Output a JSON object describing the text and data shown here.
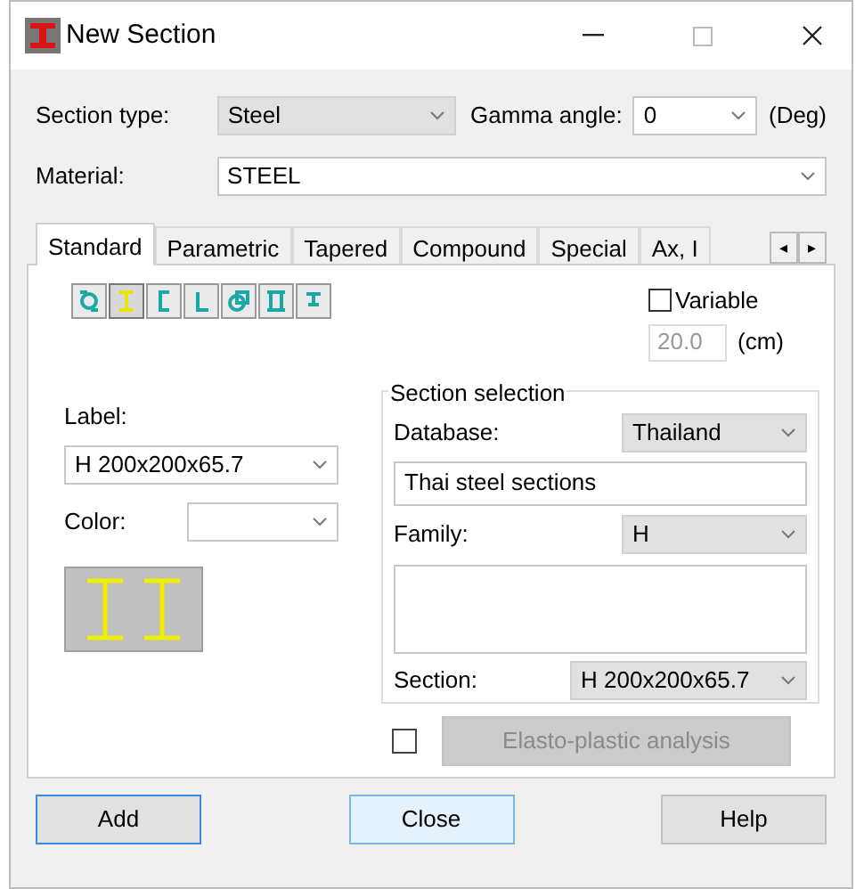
{
  "window": {
    "title": "New Section"
  },
  "section_type": {
    "label": "Section type:",
    "value": "Steel"
  },
  "gamma_angle": {
    "label": "Gamma angle:",
    "value": "0",
    "unit": "(Deg)"
  },
  "material": {
    "label": "Material:",
    "value": "STEEL"
  },
  "tabs": [
    {
      "label": "Standard",
      "selected": true
    },
    {
      "label": "Parametric",
      "selected": false
    },
    {
      "label": "Tapered",
      "selected": false
    },
    {
      "label": "Compound",
      "selected": false
    },
    {
      "label": "Special",
      "selected": false
    },
    {
      "label": "Ax, I",
      "selected": false
    }
  ],
  "tab_scroll": {
    "left": "◂",
    "right": "▸"
  },
  "shape_tools": [
    {
      "kind": "rolled",
      "selected": false
    },
    {
      "kind": "i",
      "selected": true
    },
    {
      "kind": "channel",
      "selected": false
    },
    {
      "kind": "angle",
      "selected": false
    },
    {
      "kind": "tube",
      "selected": false
    },
    {
      "kind": "double",
      "selected": false
    },
    {
      "kind": "tee",
      "selected": false
    }
  ],
  "variable": {
    "label": "Variable",
    "checked": false,
    "value": "20.0",
    "unit": "(cm)"
  },
  "label_field": {
    "label": "Label:",
    "value": "H 200x200x65.7"
  },
  "color_field": {
    "label": "Color:"
  },
  "section_selection": {
    "title": "Section selection",
    "database_label": "Database:",
    "database": "Thailand",
    "description": "Thai steel sections",
    "family_label": "Family:",
    "family": "H",
    "section_label": "Section:",
    "section": "H 200x200x65.7"
  },
  "elasto_plastic": {
    "label": "Elasto-plastic analysis",
    "checked": false,
    "disabled": true
  },
  "buttons": [
    {
      "label": "Add",
      "kind": "default"
    },
    {
      "label": "Close",
      "kind": "focused"
    },
    {
      "label": "Help",
      "kind": "normal"
    }
  ]
}
